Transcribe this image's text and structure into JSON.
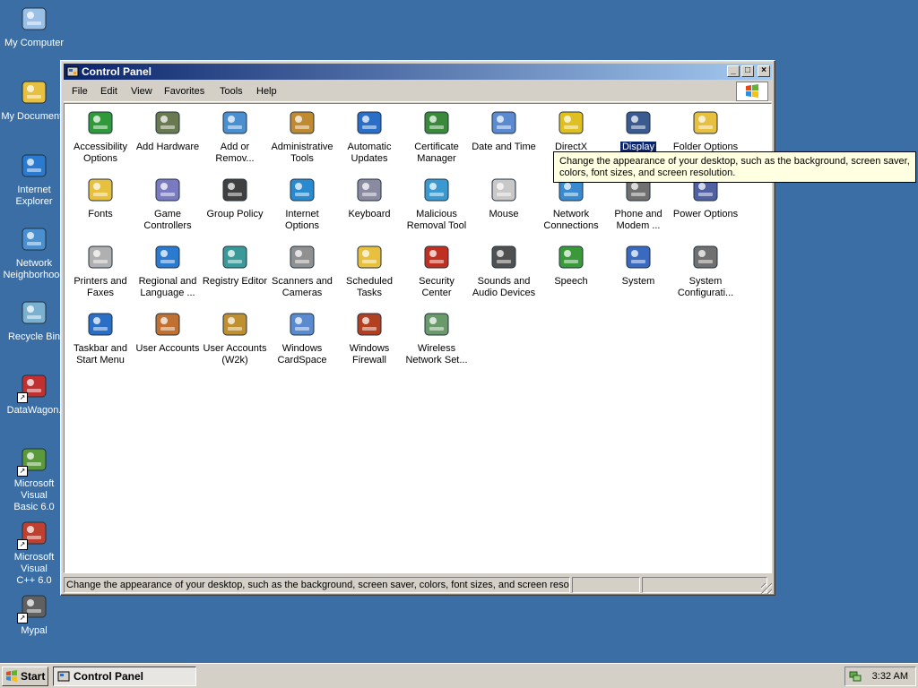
{
  "desktop": {
    "icons": [
      {
        "label": "My Computer",
        "icon": "my-computer-icon"
      },
      {
        "label": "My Documents",
        "icon": "my-documents-icon"
      },
      {
        "label": "Internet\nExplorer",
        "icon": "internet-explorer-icon"
      },
      {
        "label": "Network\nNeighborhood",
        "icon": "network-icon"
      },
      {
        "label": "Recycle Bin",
        "icon": "recycle-bin-icon"
      },
      {
        "label": "DataWagon.",
        "icon": "datawagon-icon"
      },
      {
        "label": "Microsoft Visual\nBasic 6.0",
        "icon": "vb6-icon"
      },
      {
        "label": "Microsoft Visual\nC++ 6.0",
        "icon": "vc6-icon"
      },
      {
        "label": "Mypal",
        "icon": "mypal-icon"
      }
    ]
  },
  "window": {
    "title": "Control Panel",
    "buttons": {
      "minimize": "_",
      "maximize": "□",
      "close": "×"
    },
    "menu": [
      "File",
      "Edit",
      "View",
      "Favorites",
      "Tools",
      "Help"
    ],
    "items": [
      {
        "label": "Accessibility\nOptions",
        "icon": "accessibility-icon"
      },
      {
        "label": "Add Hardware",
        "icon": "add-hardware-icon"
      },
      {
        "label": "Add or\nRemov...",
        "icon": "add-remove-programs-icon"
      },
      {
        "label": "Administrative\nTools",
        "icon": "admin-tools-icon"
      },
      {
        "label": "Automatic\nUpdates",
        "icon": "automatic-updates-icon"
      },
      {
        "label": "Certificate\nManager",
        "icon": "certificate-icon"
      },
      {
        "label": "Date and Time",
        "icon": "date-time-icon"
      },
      {
        "label": "DirectX\nD...",
        "icon": "directx-icon"
      },
      {
        "label": "Display",
        "icon": "display-icon"
      },
      {
        "label": "Folder Options",
        "icon": "folder-options-icon"
      },
      {
        "label": "Fonts",
        "icon": "fonts-icon"
      },
      {
        "label": "Game\nControllers",
        "icon": "game-controllers-icon"
      },
      {
        "label": "Group Policy",
        "icon": "group-policy-icon"
      },
      {
        "label": "Internet\nOptions",
        "icon": "internet-options-icon"
      },
      {
        "label": "Keyboard",
        "icon": "keyboard-icon"
      },
      {
        "label": "Malicious\nRemoval Tool",
        "icon": "malicious-removal-icon"
      },
      {
        "label": "Mouse",
        "icon": "mouse-icon"
      },
      {
        "label": "Network\nConnections",
        "icon": "network-connections-icon"
      },
      {
        "label": "Phone and\nModem ...",
        "icon": "phone-modem-icon"
      },
      {
        "label": "Power Options",
        "icon": "power-options-icon"
      },
      {
        "label": "Printers and\nFaxes",
        "icon": "printers-icon"
      },
      {
        "label": "Regional and\nLanguage ...",
        "icon": "regional-icon"
      },
      {
        "label": "Registry Editor",
        "icon": "registry-editor-icon"
      },
      {
        "label": "Scanners and\nCameras",
        "icon": "scanners-icon"
      },
      {
        "label": "Scheduled\nTasks",
        "icon": "scheduled-tasks-icon"
      },
      {
        "label": "Security\nCenter",
        "icon": "security-center-icon"
      },
      {
        "label": "Sounds and\nAudio Devices",
        "icon": "sounds-icon"
      },
      {
        "label": "Speech",
        "icon": "speech-icon"
      },
      {
        "label": "System",
        "icon": "system-icon"
      },
      {
        "label": "System\nConfigurati...",
        "icon": "system-config-icon"
      },
      {
        "label": "Taskbar and\nStart Menu",
        "icon": "taskbar-icon"
      },
      {
        "label": "User Accounts",
        "icon": "user-accounts-icon"
      },
      {
        "label": "User Accounts\n(W2k)",
        "icon": "user-accounts-w2k-icon"
      },
      {
        "label": "Windows\nCardSpace",
        "icon": "cardspace-icon"
      },
      {
        "label": "Windows\nFirewall",
        "icon": "firewall-icon"
      },
      {
        "label": "Wireless\nNetwork Set...",
        "icon": "wireless-icon"
      }
    ],
    "tooltip": "Change the appearance of your desktop, such as the background, screen saver, colors, font sizes, and screen resolution.",
    "status": "Change the appearance of your desktop, such as the background, screen saver, colors, font sizes, and screen resolution."
  },
  "taskbar": {
    "start_label": "Start",
    "task_label": "Control Panel",
    "clock": "3:32 AM"
  },
  "colors": {
    "desktop": "#3a6ea5",
    "title_gradient_start": "#0a246a",
    "title_gradient_end": "#a6caf0",
    "selection": "#0a246a"
  }
}
